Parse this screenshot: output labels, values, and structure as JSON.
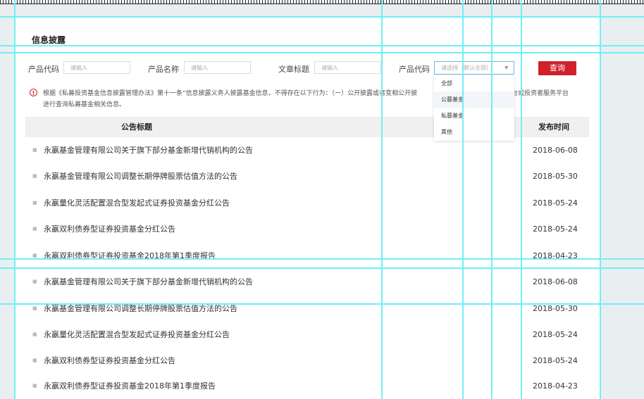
{
  "section_title": "信息披露",
  "filters": {
    "product_code_label": "产品代码",
    "product_code_placeholder": "请输入",
    "product_name_label": "产品名称",
    "product_name_placeholder": "请输入",
    "article_title_label": "文章标题",
    "article_title_placeholder": "请输入",
    "product_type_label": "产品代码",
    "product_type_placeholder": "请选择（默认全部）",
    "query_button": "查询"
  },
  "dropdown": {
    "options": [
      "全部",
      "公募基金",
      "私募基金",
      "其他"
    ],
    "highlighted": "公募基金"
  },
  "notice": {
    "text_line1": "根据《私募投资基金信息披露管理办法》第十一条“信息披露义务人披露基金信息，不得存在以下行为：（一）公开披露或者变相公开披",
    "text_line1_end": "台或投资者服务平台",
    "text_line2": "进行查询私募基金相关信息。"
  },
  "table": {
    "header_title": "公告标题",
    "header_date": "发布时间",
    "rows": [
      {
        "title": "永嬴基金管理有限公司关于旗下部分基金新增代销机构的公告",
        "date": "2018-06-08"
      },
      {
        "title": "永嬴基金管理有限公司调整长期停牌股票估值方法的公告",
        "date": "2018-05-30"
      },
      {
        "title": "永嬴量化灵活配置混合型发起式证券投资基金分红公告",
        "date": "2018-05-24"
      },
      {
        "title": "永嬴双利债券型证券投资基金分红公告",
        "date": "2018-05-24"
      },
      {
        "title": "永嬴双利债券型证券投资基金2018年第1季度报告",
        "date": "2018-04-23"
      },
      {
        "title": "永嬴基金管理有限公司关于旗下部分基金新增代销机构的公告",
        "date": "2018-06-08"
      },
      {
        "title": "永嬴基金管理有限公司调整长期停牌股票估值方法的公告",
        "date": "2018-05-30"
      },
      {
        "title": "永嬴量化灵活配置混合型发起式证券投资基金分红公告",
        "date": "2018-05-24"
      },
      {
        "title": "永嬴双利债券型证券投资基金分红公告",
        "date": "2018-05-24"
      },
      {
        "title": "永嬴双利债券型证券投资基金2018年第1季度报告",
        "date": "2018-04-23"
      }
    ]
  },
  "colors": {
    "accent_red": "#d0202a",
    "guide_cyan": "#6ff0f5",
    "select_border": "#6fb6e8"
  }
}
